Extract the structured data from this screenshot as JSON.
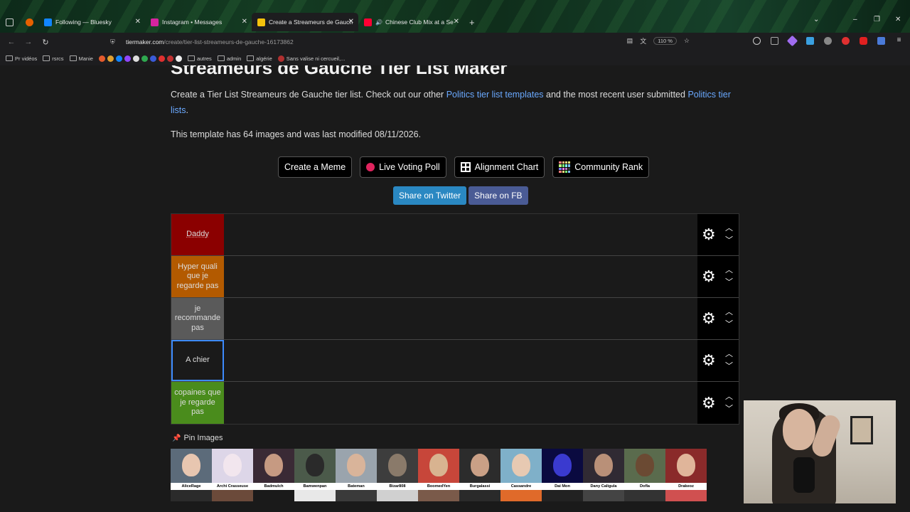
{
  "browser": {
    "tabs": [
      {
        "title": "",
        "favicon_color": "#e66000"
      },
      {
        "title": "Following — Bluesky",
        "favicon_color": "#1185fe"
      },
      {
        "title": "Instagram • Messages",
        "favicon_color": "#d6249f"
      },
      {
        "title": "Create a Streameurs de Gauche",
        "favicon_color": "#f4c20d"
      },
      {
        "title": "Chinese Club Mix at a Senior",
        "favicon_color": "#ff0033"
      }
    ],
    "new_tab": "+",
    "url_host": "tiermaker.com",
    "url_path": "/create/tier-list-streameurs-de-gauche-16173862",
    "zoom": "110 %",
    "bookmarks": [
      "Pr vidéos",
      "rsrcs",
      "Manie",
      "autres",
      "admin",
      "algérie",
      "Sans valise ni cercueil,..."
    ]
  },
  "page": {
    "title": "Streameurs de Gauche Tier List Maker",
    "intro_1": "Create a Tier List Streameurs de Gauche tier list. Check out our other ",
    "intro_link_1": "Politics tier list templates",
    "intro_2": " and the most recent user submitted ",
    "intro_link_2": "Politics tier lists",
    "intro_3": ".",
    "info": "This template has 64 images and was last modified 08/11/2026.",
    "buttons": {
      "meme": "Create a Meme",
      "poll": "Live Voting Poll",
      "alignment": "Alignment Chart",
      "community": "Community Rank"
    },
    "share_twitter": "Share on Twitter",
    "share_fb": "Share on FB",
    "tiers": [
      {
        "label": "Daddy",
        "color": "#8b0000"
      },
      {
        "label": "Hyper quali que je regarde pas",
        "color": "#b35a00"
      },
      {
        "label": "je recommande pas",
        "color": "#5a5a5a"
      },
      {
        "label": "A chier",
        "color": "#1a1a1a"
      },
      {
        "label": "copaines que je regarde pas",
        "color": "#4a8c1c"
      }
    ],
    "pin_images": "Pin Images",
    "images": [
      {
        "name": "AliceRage",
        "bg": "#5c6b7a",
        "face": "#e8c6b0"
      },
      {
        "name": "Archi Crasseuse",
        "bg": "#ddd6e8",
        "face": "#f2e6ee"
      },
      {
        "name": "Badmulch",
        "bg": "#3a2a35",
        "face": "#c69a82"
      },
      {
        "name": "Bamwenpan",
        "bg": "#4b5a4a",
        "face": "#2a2a2a"
      },
      {
        "name": "Bateman",
        "bg": "#9aa4ad",
        "face": "#d9b49a"
      },
      {
        "name": "Bizar808",
        "bg": "#3d3d3d",
        "face": "#8a7a6a"
      },
      {
        "name": "BoomedYen",
        "bg": "#c7463a",
        "face": "#d8b390"
      },
      {
        "name": "Burgalassi",
        "bg": "#2c2c2c",
        "face": "#caa086"
      },
      {
        "name": "Cassandre",
        "bg": "#7fb0c9",
        "face": "#e7c9b2"
      },
      {
        "name": "Dai Mon",
        "bg": "#0a0a40",
        "face": "#3a3acf"
      },
      {
        "name": "Dany Caligula",
        "bg": "#302a33",
        "face": "#b99078"
      },
      {
        "name": "Dofla",
        "bg": "#5a6b4d",
        "face": "#6b4a33"
      },
      {
        "name": "Drakeoz",
        "bg": "#8a2a2a",
        "face": "#e0b59a"
      }
    ]
  }
}
